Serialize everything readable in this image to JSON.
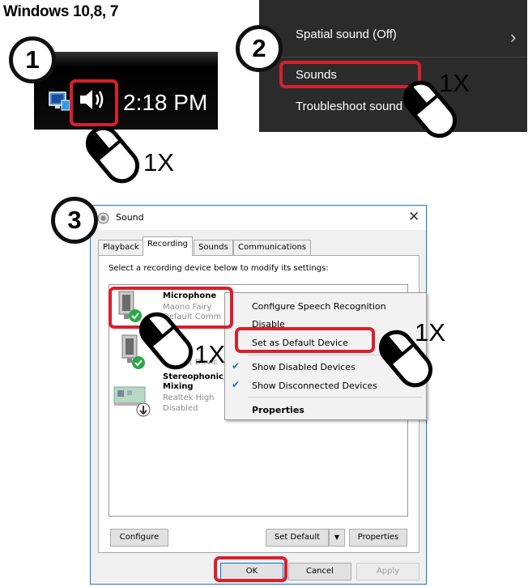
{
  "heading": "Windows 10,8, 7",
  "steps": [
    "1",
    "2",
    "3"
  ],
  "click_count_label": "1X",
  "panel1": {
    "clock": "2:18 PM",
    "icons": [
      "network-icon",
      "speaker-icon"
    ]
  },
  "panel2": {
    "menu_items": [
      {
        "label": "Spatial sound (Off)",
        "has_submenu": true
      },
      {
        "label": "Sounds",
        "highlighted": true
      },
      {
        "label": "Troubleshoot sound",
        "truncated_display": "Troubleshoot sound"
      }
    ]
  },
  "dialog": {
    "title": "Sound",
    "tabs": [
      "Playback",
      "Recording",
      "Sounds",
      "Communications"
    ],
    "active_tab": "Recording",
    "instruction": "Select a recording device below to modify its settings:",
    "devices": [
      {
        "name": "Microphone",
        "line2": "Maono Fairy",
        "line3": "Default Comm",
        "status": "default"
      },
      {
        "name": "",
        "line2": "",
        "line3": "Default Devic",
        "status": "default"
      },
      {
        "name_line1": "Stereophonic",
        "name_line2": "Mixing",
        "line2": "Realtek High",
        "line3": "Disabled",
        "status": "disabled"
      }
    ],
    "buttons": {
      "configure": "Configure",
      "set_default": "Set Default",
      "properties": "Properties",
      "ok": "OK",
      "cancel": "Cancel",
      "apply": "Apply"
    }
  },
  "context_menu": {
    "items": [
      {
        "label": "Configure Speech Recognition"
      },
      {
        "label": "Disable"
      },
      {
        "label": "Set as Default Device",
        "highlighted": true
      },
      {
        "label": "Show Disabled Devices",
        "checked": true
      },
      {
        "label": "Show Disconnected Devices",
        "checked": true
      },
      {
        "label": "Properties",
        "bold": true
      }
    ]
  },
  "colors": {
    "highlight_red": "#d8202c",
    "check_blue": "#1f6fbf",
    "status_green": "#2aa84a",
    "titlebar_border": "#1a78c6"
  }
}
